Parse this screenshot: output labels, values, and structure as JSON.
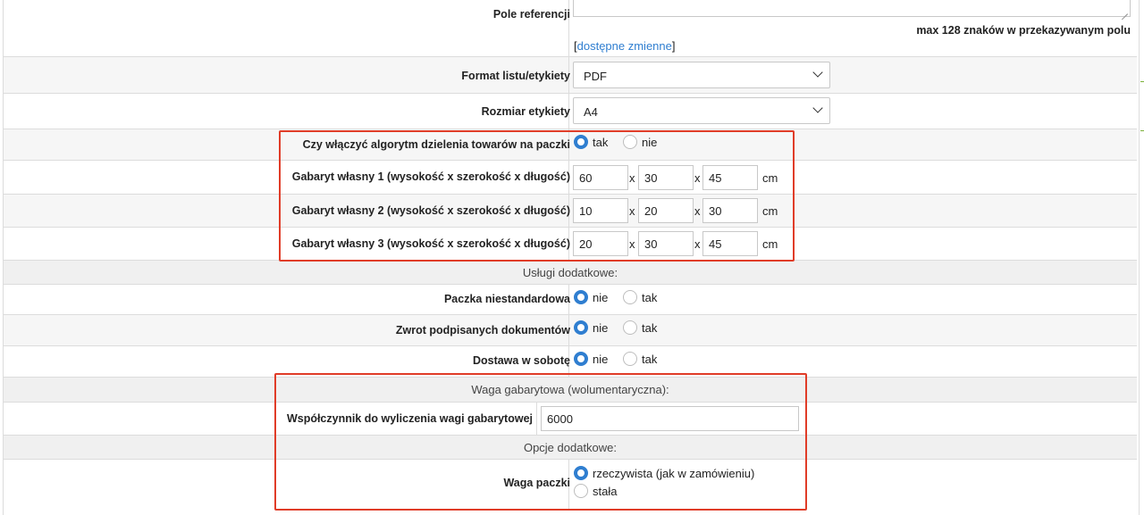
{
  "pole_referencji": {
    "label": "Pole referencji",
    "hint": "max 128 znaków w przekazywanym polu",
    "link_open": "[",
    "link_text": "dostępne zmienne",
    "link_close": "]"
  },
  "format": {
    "label": "Format listu/etykiety",
    "value": "PDF"
  },
  "rozmiar": {
    "label": "Rozmiar etykiety",
    "value": "A4"
  },
  "algorytm": {
    "label": "Czy włączyć algorytm dzielenia towarów na paczki",
    "opt1": "tak",
    "opt2": "nie"
  },
  "gabaryty": [
    {
      "label": "Gabaryt własny 1 (wysokość x szerokość x długość)",
      "v1": "60",
      "v2": "30",
      "v3": "45"
    },
    {
      "label": "Gabaryt własny 2 (wysokość x szerokość x długość)",
      "v1": "10",
      "v2": "20",
      "v3": "30"
    },
    {
      "label": "Gabaryt własny 3 (wysokość x szerokość x długość)",
      "v1": "20",
      "v2": "30",
      "v3": "45"
    }
  ],
  "sep": "x",
  "unit": "cm",
  "uslugi_header": "Usługi dodatkowe:",
  "uslugi": [
    {
      "label": "Paczka niestandardowa",
      "opt1": "nie",
      "opt2": "tak"
    },
    {
      "label": "Zwrot podpisanych dokumentów",
      "opt1": "nie",
      "opt2": "tak"
    },
    {
      "label": "Dostawa w sobotę",
      "opt1": "nie",
      "opt2": "tak"
    }
  ],
  "waga_header": "Waga gabarytowa (wolumentaryczna):",
  "wspolczynnik": {
    "label": "Współczynnik do wyliczenia wagi gabarytowej",
    "value": "6000"
  },
  "opcje_header": "Opcje dodatkowe:",
  "waga_paczki": {
    "label": "Waga paczki",
    "opt1": "rzeczywista (jak w zamówieniu)",
    "opt2": "stała"
  },
  "colors": {
    "accent": "#2f7ed0",
    "highlight": "#e03c28"
  }
}
